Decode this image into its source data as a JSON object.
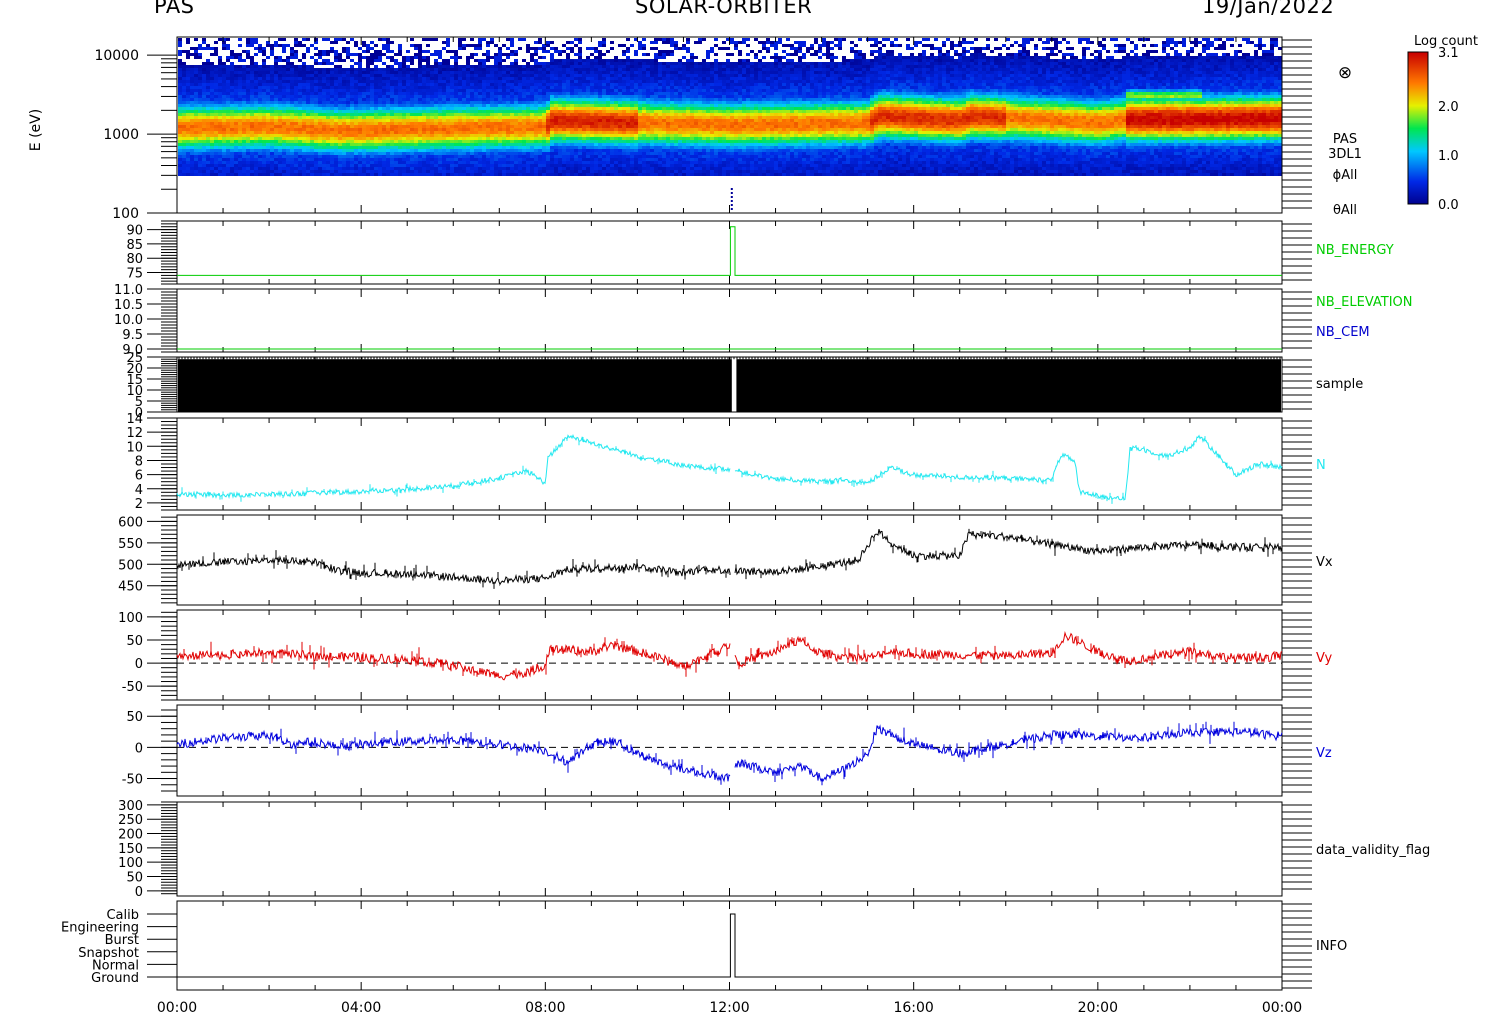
{
  "header": {
    "left": "PAS",
    "center": "SOLAR-ORBITER",
    "right": "19/Jan/2022"
  },
  "colors": {
    "nb_energy": "#00cc00",
    "nb_elevation": "#00cc00",
    "nb_cem": "#0000cc",
    "sample": "#000000",
    "n": "#22e8f0",
    "vx": "#000000",
    "vy": "#e00000",
    "vz": "#0000dd",
    "info": "#000000"
  },
  "chart_data": [
    {
      "type": "heatmap",
      "panel": "spectrogram",
      "ylabel": "E (eV)",
      "yscale": "log",
      "ylim": [
        100,
        17000
      ],
      "yticks": [
        "100",
        "1000",
        "10000"
      ],
      "right_labels": [
        "PAS",
        "3DL1",
        "ϕAll",
        "θAll"
      ],
      "colorbar": {
        "title": "Log count",
        "range": [
          0.0,
          3.1
        ],
        "ticks": [
          "3.1",
          "2.0",
          "1.0",
          "0.0"
        ],
        "colormap": "rainbow"
      },
      "peak_energy_track": {
        "x_hours": [
          0,
          2,
          3.5,
          5,
          8,
          8.1,
          10,
          12,
          15,
          15.2,
          17,
          17.2,
          20,
          20.6,
          22,
          24
        ],
        "energy_ev": [
          1250,
          1300,
          1150,
          1200,
          1300,
          1550,
          1450,
          1350,
          1450,
          1750,
          1550,
          1750,
          1450,
          1600,
          1600,
          1650
        ]
      },
      "cross_marker": "⊗"
    },
    {
      "type": "line",
      "panel": "nb_energy",
      "label": "NB_ENERGY",
      "ylim": [
        71,
        93
      ],
      "yticks": [
        75,
        80,
        85,
        90
      ],
      "x_hours": [
        0,
        12.02,
        12.02,
        12.12,
        12.12,
        24
      ],
      "values": [
        74,
        74,
        91,
        91,
        74,
        74
      ]
    },
    {
      "type": "line",
      "panel": "nb_elevation",
      "labels": [
        "NB_ELEVATION",
        "NB_CEM"
      ],
      "ylim": [
        8.9,
        11.0
      ],
      "yticks": [
        "9.0",
        "9.5",
        "10.0",
        "10.5",
        "11.0"
      ],
      "x_hours": [
        0,
        24
      ],
      "values": [
        9.0,
        9.0
      ]
    },
    {
      "type": "bar",
      "panel": "sample",
      "label": "sample",
      "ylim": [
        0,
        25
      ],
      "yticks": [
        0,
        5,
        10,
        15,
        20,
        25
      ],
      "gap_hours": [
        12.05,
        12.15
      ]
    },
    {
      "type": "line",
      "panel": "density",
      "label": "N",
      "ylim": [
        1,
        14
      ],
      "yticks": [
        2,
        4,
        6,
        8,
        10,
        12,
        14
      ],
      "x_hours": [
        0,
        1,
        2,
        3,
        4,
        5,
        6,
        7,
        7.6,
        8,
        8.05,
        8.5,
        9,
        10,
        11,
        11.5,
        12,
        12.5,
        13,
        14,
        14.5,
        15,
        15.5,
        16,
        17,
        18,
        19,
        19.2,
        19.5,
        19.6,
        20,
        20.6,
        20.7,
        21,
        21.5,
        22,
        22.2,
        22.5,
        23,
        23.5,
        24
      ],
      "values": [
        3.3,
        3.1,
        3.2,
        3.4,
        3.6,
        3.9,
        4.4,
        5.5,
        6.5,
        4.8,
        8.3,
        11.5,
        10.5,
        8.6,
        7.3,
        6.9,
        6.8,
        6.0,
        5.4,
        5.0,
        5.2,
        4.8,
        7.0,
        6.0,
        5.6,
        5.5,
        5.2,
        8.8,
        8.0,
        3.5,
        3.0,
        2.6,
        9.8,
        9.5,
        8.6,
        9.8,
        11.5,
        9.5,
        6.0,
        7.5,
        7.0
      ]
    },
    {
      "type": "line",
      "panel": "vx",
      "label": "Vx",
      "ylim": [
        405,
        615
      ],
      "yticks": [
        450,
        500,
        550,
        600
      ],
      "x_hours": [
        0,
        1,
        2,
        3,
        3.5,
        4,
        5,
        6,
        7,
        8,
        8.5,
        9,
        10,
        11,
        11.5,
        12,
        13,
        14,
        14.8,
        15.2,
        15.6,
        16,
        17,
        17.2,
        18,
        19,
        20,
        21,
        22,
        23,
        24
      ],
      "values": [
        500,
        505,
        510,
        505,
        485,
        480,
        478,
        470,
        462,
        468,
        488,
        490,
        495,
        480,
        490,
        485,
        482,
        495,
        510,
        578,
        545,
        520,
        520,
        570,
        565,
        545,
        530,
        540,
        545,
        540,
        540
      ]
    },
    {
      "type": "line",
      "panel": "vy",
      "label": "Vy",
      "ylim": [
        -80,
        115
      ],
      "yticks": [
        -50,
        0,
        50,
        100
      ],
      "zero_line": true,
      "x_hours": [
        0,
        1,
        2,
        3,
        4,
        5,
        6,
        7,
        7.6,
        8,
        8.1,
        9,
        9.5,
        10,
        10.5,
        11,
        11.5,
        12,
        12.2,
        13,
        13.5,
        14,
        15,
        15.5,
        16,
        17,
        18,
        19,
        19.3,
        19.6,
        20,
        20.6,
        21,
        22,
        23,
        24
      ],
      "values": [
        15,
        18,
        22,
        15,
        12,
        8,
        -5,
        -28,
        -20,
        -5,
        30,
        25,
        38,
        25,
        10,
        -8,
        15,
        40,
        0,
        25,
        50,
        20,
        10,
        25,
        20,
        18,
        15,
        22,
        60,
        45,
        25,
        5,
        10,
        25,
        10,
        15
      ]
    },
    {
      "type": "line",
      "panel": "vz",
      "label": "Vz",
      "ylim": [
        -78,
        68
      ],
      "yticks": [
        -50,
        0,
        50
      ],
      "zero_line": true,
      "x_hours": [
        0,
        1,
        2,
        2.5,
        3,
        3.5,
        4,
        5,
        6,
        7,
        8,
        8.5,
        9,
        9.5,
        10,
        10.5,
        11,
        12,
        12.2,
        13,
        13.5,
        14,
        14.5,
        15,
        15.2,
        16,
        17,
        18,
        19,
        20,
        21,
        22,
        23,
        24
      ],
      "values": [
        5,
        15,
        20,
        5,
        10,
        0,
        5,
        10,
        12,
        5,
        -5,
        -25,
        5,
        10,
        -10,
        -25,
        -35,
        -50,
        -25,
        -40,
        -30,
        -50,
        -35,
        -10,
        30,
        5,
        -10,
        5,
        20,
        18,
        15,
        25,
        25,
        18
      ]
    },
    {
      "type": "line",
      "panel": "data_validity_flag",
      "label": "data_validity_flag",
      "ylim": [
        -18,
        310
      ],
      "yticks": [
        0,
        50,
        100,
        150,
        200,
        250,
        300
      ]
    },
    {
      "type": "line",
      "panel": "info",
      "label": "INFO",
      "categories": [
        "Ground",
        "Normal",
        "Snapshot",
        "Burst",
        "Engineering",
        "Calib"
      ],
      "x_hours": [
        0,
        12.02,
        12.02,
        12.12,
        12.12,
        24
      ],
      "values": [
        0,
        0,
        5,
        5,
        0,
        0
      ],
      "xticks": [
        "00:00",
        "04:00",
        "08:00",
        "12:00",
        "16:00",
        "20:00",
        "00:00"
      ]
    }
  ]
}
